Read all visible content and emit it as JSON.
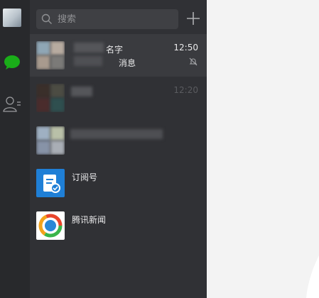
{
  "search": {
    "placeholder": "搜索"
  },
  "chats": [
    {
      "name_fragment": "名字",
      "preview_fragment": "消息",
      "time": "12:50",
      "muted": true
    },
    {
      "time": "12:20"
    },
    {},
    {
      "name": "订阅号"
    },
    {
      "name": "腾讯新闻"
    }
  ],
  "icons": {
    "nav": [
      "avatar",
      "chat-bubble-icon",
      "contacts-icon"
    ],
    "search": "search-icon",
    "add": "plus-icon",
    "mute": "mute-bell-icon"
  },
  "colors": {
    "chat_green": "#1aad19",
    "subscription_blue": "#1f7fd6"
  }
}
